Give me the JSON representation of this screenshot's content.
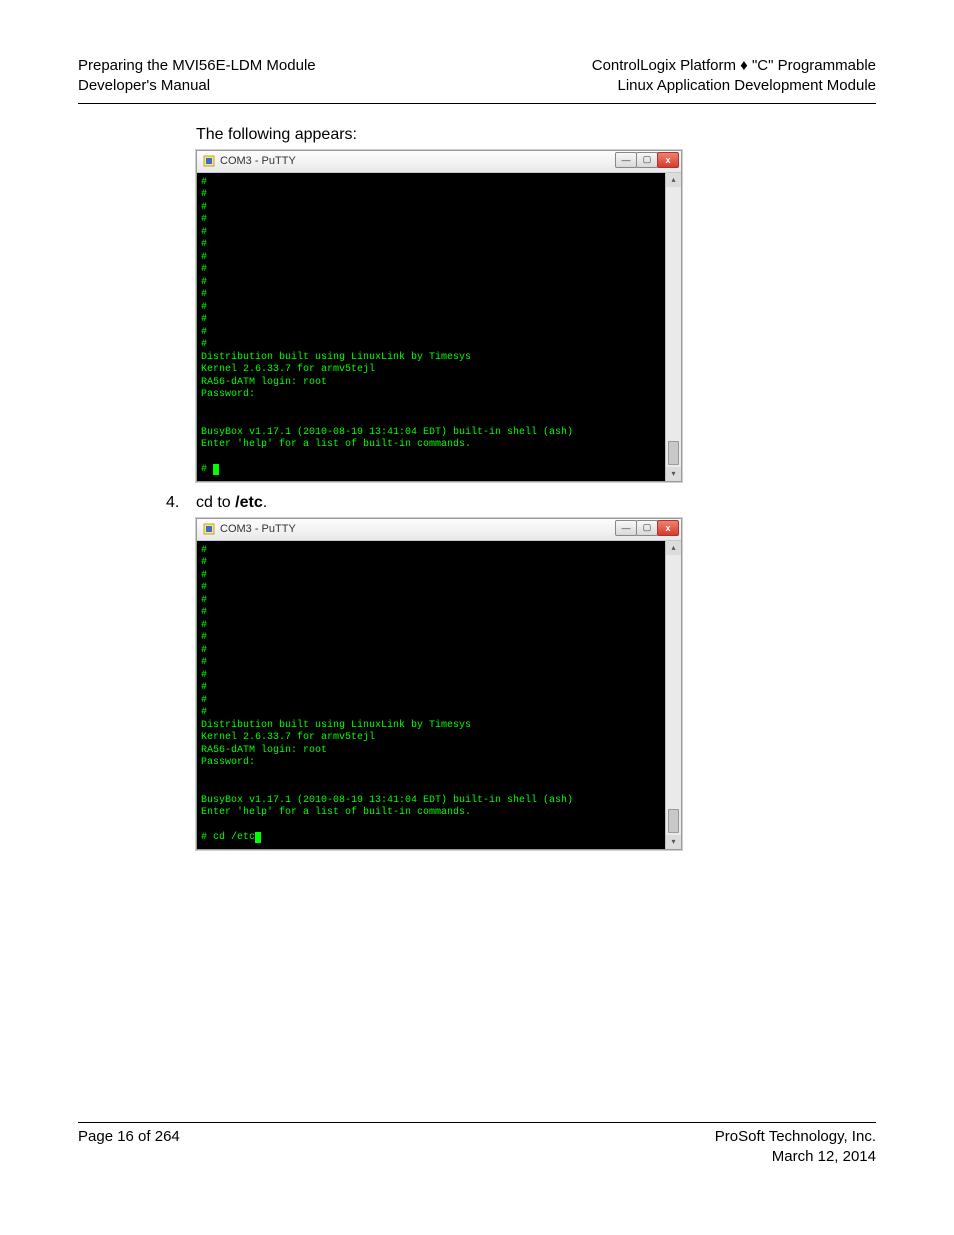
{
  "header": {
    "left_line1": "Preparing the MVI56E-LDM Module",
    "left_line2": "Developer's Manual",
    "right_line1": "ControlLogix Platform ♦ \"C\" Programmable",
    "right_line2": "Linux Application Development Module"
  },
  "body": {
    "intro": "The following appears:",
    "step4_num": "4.",
    "step4_pre": "cd to ",
    "step4_bold": "/etc",
    "step4_post": "."
  },
  "putty": {
    "title": "COM3 - PuTTY",
    "icon_name": "putty-icon",
    "min_glyph": "—",
    "max_glyph": "▢",
    "close_glyph": "x",
    "scroll_up_glyph": "▴",
    "scroll_down_glyph": "▾",
    "terminal1_lines": [
      "#",
      "#",
      "#",
      "#",
      "#",
      "#",
      "#",
      "#",
      "#",
      "#",
      "#",
      "#",
      "#",
      "#",
      "Distribution built using LinuxLink by Timesys",
      "Kernel 2.6.33.7 for armv5tejl",
      "RA56-dATM login: root",
      "Password:",
      "",
      "",
      "BusyBox v1.17.1 (2010-08-19 13:41:04 EDT) built-in shell (ash)",
      "Enter 'help' for a list of built-in commands.",
      "",
      "# "
    ],
    "terminal2_lines": [
      "#",
      "#",
      "#",
      "#",
      "#",
      "#",
      "#",
      "#",
      "#",
      "#",
      "#",
      "#",
      "#",
      "#",
      "Distribution built using LinuxLink by Timesys",
      "Kernel 2.6.33.7 for armv5tejl",
      "RA56-dATM login: root",
      "Password:",
      "",
      "",
      "BusyBox v1.17.1 (2010-08-19 13:41:04 EDT) built-in shell (ash)",
      "Enter 'help' for a list of built-in commands.",
      "",
      "# cd /etc"
    ],
    "cursor_block": " "
  },
  "footer": {
    "left": "Page 16 of 264",
    "right_line1": "ProSoft Technology, Inc.",
    "right_line2": "March 12, 2014"
  }
}
